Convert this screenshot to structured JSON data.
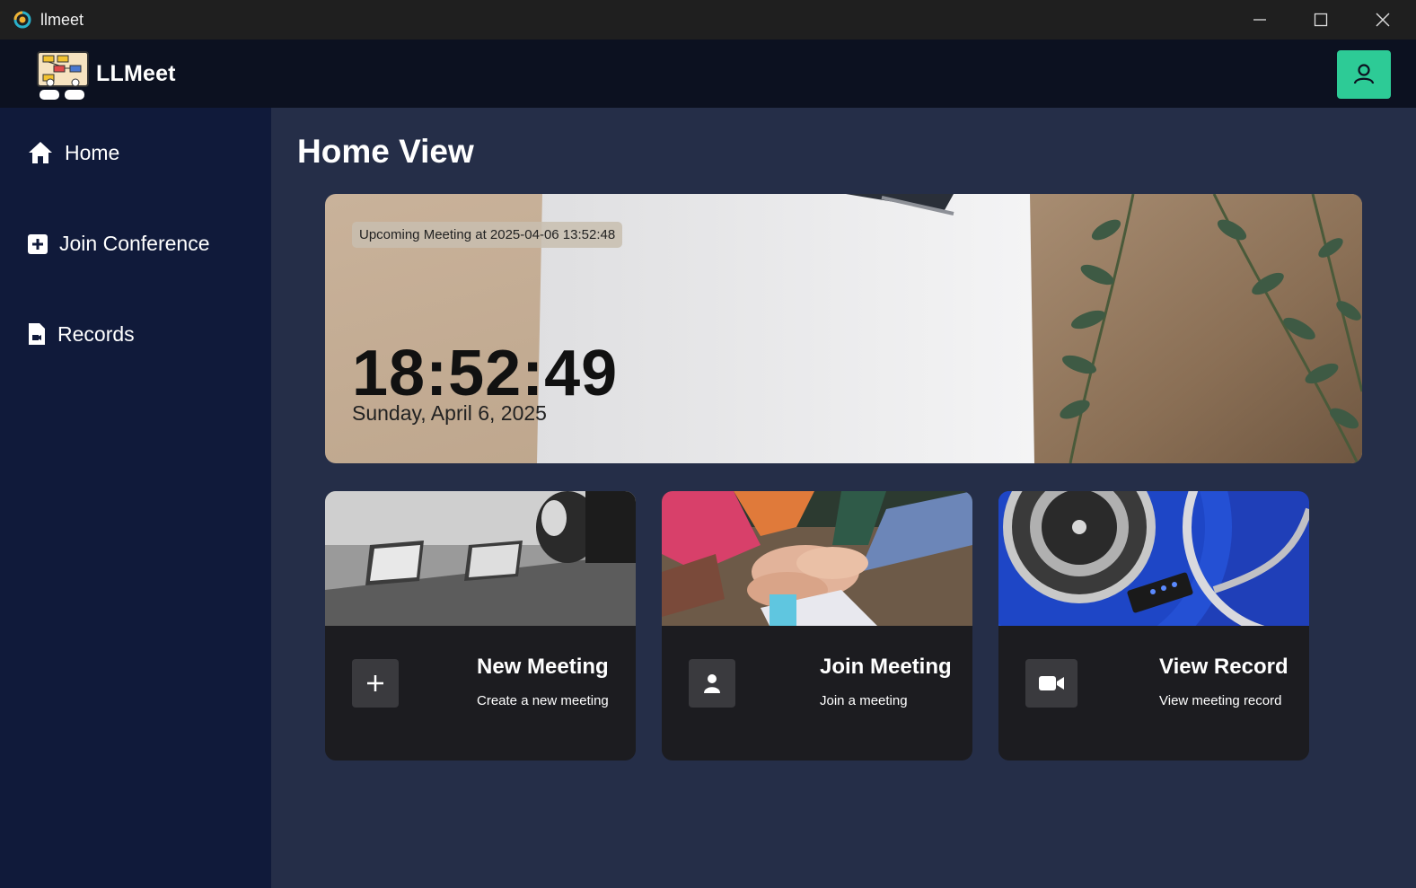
{
  "window": {
    "title": "llmeet"
  },
  "header": {
    "brand": "LLMeet"
  },
  "sidebar": {
    "items": [
      {
        "label": "Home",
        "icon": "home-icon"
      },
      {
        "label": "Join Conference",
        "icon": "plus-square-icon"
      },
      {
        "label": "Records",
        "icon": "file-video-icon"
      }
    ]
  },
  "main": {
    "title": "Home View",
    "hero": {
      "upcoming": "Upcoming Meeting at 2025-04-06 13:52:48",
      "time": "18:52:49",
      "date": "Sunday, April 6, 2025"
    },
    "cards": [
      {
        "title": "New Meeting",
        "subtitle": "Create a new meeting",
        "icon": "plus-icon"
      },
      {
        "title": "Join Meeting",
        "subtitle": "Join a meeting",
        "icon": "user-icon"
      },
      {
        "title": "View Record",
        "subtitle": "View meeting record",
        "icon": "video-camera-icon"
      }
    ]
  },
  "colors": {
    "accent": "#2dcb96",
    "sidebar": "#101a3a",
    "main": "#252e48",
    "header": "#0c1120",
    "card": "#1c1c20"
  }
}
